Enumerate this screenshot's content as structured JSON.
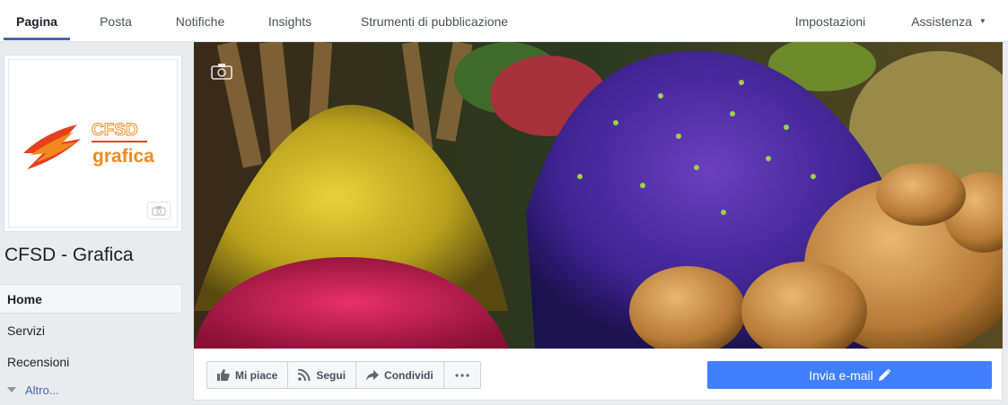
{
  "topnav": {
    "tabs": [
      "Pagina",
      "Posta",
      "Notifiche",
      "Insights",
      "Strumenti di pubblicazione"
    ],
    "settings": "Impostazioni",
    "help": "Assistenza"
  },
  "profile": {
    "logo_line1": "CFSD",
    "logo_line2": "grafica",
    "page_name": "CFSD - Grafica",
    "camera_icon": "camera-icon"
  },
  "leftnav": {
    "items": [
      "Home",
      "Servizi",
      "Recensioni"
    ],
    "more": "Altro..."
  },
  "actions": {
    "like": "Mi piace",
    "follow": "Segui",
    "share": "Condividi",
    "more_icon": "ellipsis-icon",
    "email": "Invia e-mail"
  },
  "colors": {
    "accent": "#4267b2",
    "email_button": "#4080ff",
    "logo_orange": "#f08a1d",
    "logo_red": "#e6401f"
  }
}
